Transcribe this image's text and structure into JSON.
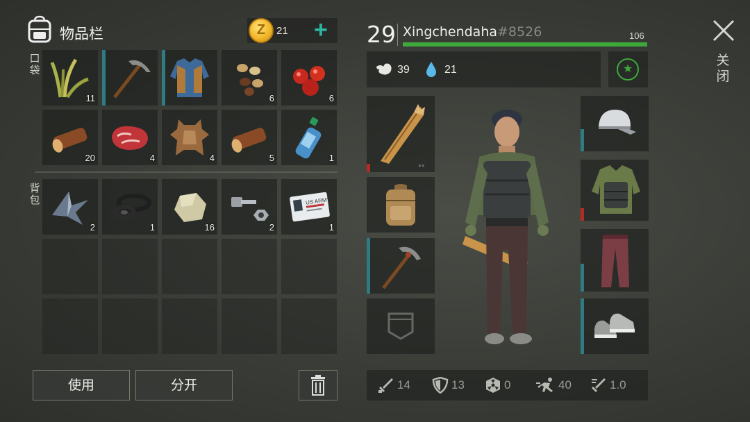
{
  "inventory": {
    "title": "物品栏",
    "pockets_label": "口袋",
    "backpack_label": "背包",
    "coins": "21",
    "pockets": [
      {
        "icon": "grass-icon",
        "count": "11",
        "durability": false
      },
      {
        "icon": "pickaxe-icon",
        "count": "",
        "durability": true
      },
      {
        "icon": "jacket-icon",
        "count": "",
        "durability": true
      },
      {
        "icon": "seeds-icon",
        "count": "6",
        "durability": false
      },
      {
        "icon": "berries-icon",
        "count": "6",
        "durability": false
      },
      {
        "icon": "log-icon",
        "count": "20",
        "durability": false
      },
      {
        "icon": "raw-meat-icon",
        "count": "4",
        "durability": false
      },
      {
        "icon": "hide-icon",
        "count": "4",
        "durability": false
      },
      {
        "icon": "log-icon",
        "count": "5",
        "durability": false
      },
      {
        "icon": "water-bottle-icon",
        "count": "1",
        "durability": false
      }
    ],
    "backpack": [
      {
        "icon": "scrap-metal-icon",
        "count": "2"
      },
      {
        "icon": "rubber-parts-icon",
        "count": "1"
      },
      {
        "icon": "stone-icon",
        "count": "16"
      },
      {
        "icon": "nuts-bolts-icon",
        "count": "2"
      },
      {
        "icon": "id-card-icon",
        "count": "1",
        "card_text": "US ARMY"
      }
    ]
  },
  "buttons": {
    "use": "使用",
    "split": "分开"
  },
  "player": {
    "level": "29",
    "name": "Xingchendaha",
    "tag": "#8526",
    "xp_max": "106",
    "xp_fraction": 1.0,
    "food": "39",
    "water": "21"
  },
  "bottom_stats": {
    "attack": "14",
    "defense": "13",
    "radiation": "0",
    "speed": "40",
    "attack_speed": "1.0"
  },
  "close_label": "关闭",
  "colors": {
    "accent_teal": "#2fb5a3",
    "xp_green": "#3fa83a",
    "durability_teal": "#2e7b84",
    "durability_red": "#b52a22"
  }
}
